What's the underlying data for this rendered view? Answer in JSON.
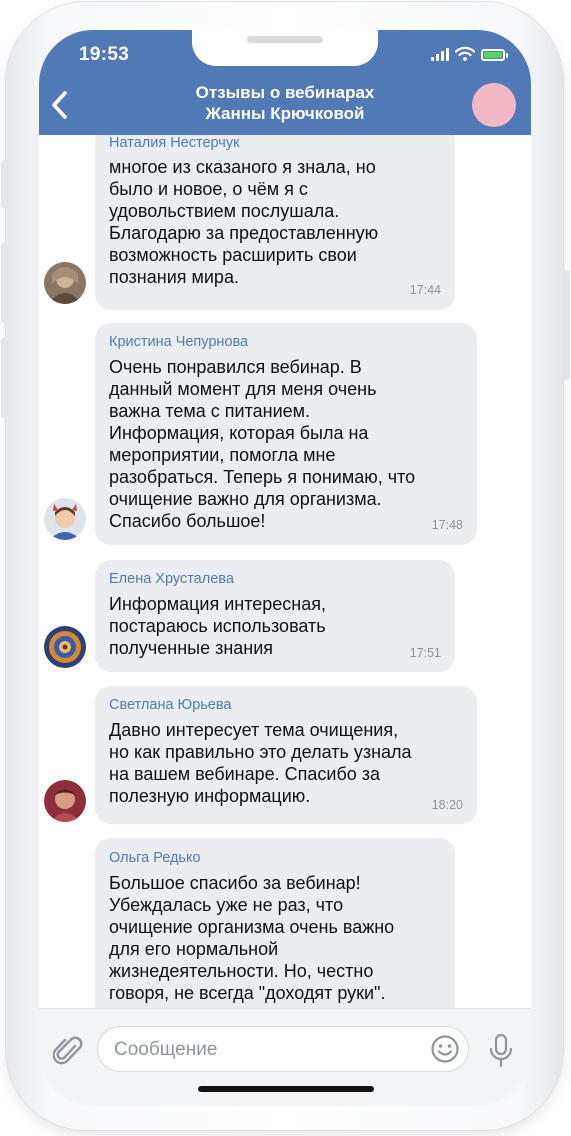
{
  "status_bar": {
    "time": "19:53"
  },
  "header": {
    "title_line1": "Отзывы о вебинарах",
    "title_line2": "Жанны Крючковой"
  },
  "messages": [
    {
      "author": "Наталия Нестерчук",
      "text": "многое из сказаного я знала, но\nбыло и новое, о чём я с\nудовольствием послушала.\nБлагодарю за предоставленную\nвозможность расширить свои\nпознания мира.",
      "time": "17:44"
    },
    {
      "author": "Кристина Чепурнова",
      "text": "Очень понравился вебинар. В\nданный момент для меня очень\nважна тема с питанием.\nИнформация, которая была на\nмероприятии, помогла мне\nразобраться. Теперь я понимаю, что\nочищение важно для организма.\nСпасибо большое!",
      "time": "17:48"
    },
    {
      "author": "Елена Хрусталева",
      "text": "Информация интересная,\nпостараюсь использовать\nполученные знания",
      "time": "17:51"
    },
    {
      "author": "Светлана Юрьева",
      "text": "Давно интересует тема очищения,\nно как правильно это делать узнала\nна вашем вебинаре. Спасибо за\nполезную информацию.",
      "time": "18:20"
    },
    {
      "author": "Ольга Редько",
      "text": "Большое спасибо за вебинар!\nУбеждалась уже не раз, что\nочищение организма очень важно\nдля его нормальной\nжизнедеятельности. Но, честно\nговоря, не всегда \"доходят руки\".",
      "time": ""
    }
  ],
  "composer": {
    "placeholder": "Сообщение"
  },
  "colors": {
    "header": "#5079b6",
    "author": "#4d7bb5",
    "bubble": "#ebedf0",
    "battery": "#5ed55a"
  },
  "icons": [
    "back-arrow-icon",
    "signal-icon",
    "wifi-icon",
    "battery-icon",
    "attach-icon",
    "emoji-icon",
    "microphone-icon"
  ]
}
